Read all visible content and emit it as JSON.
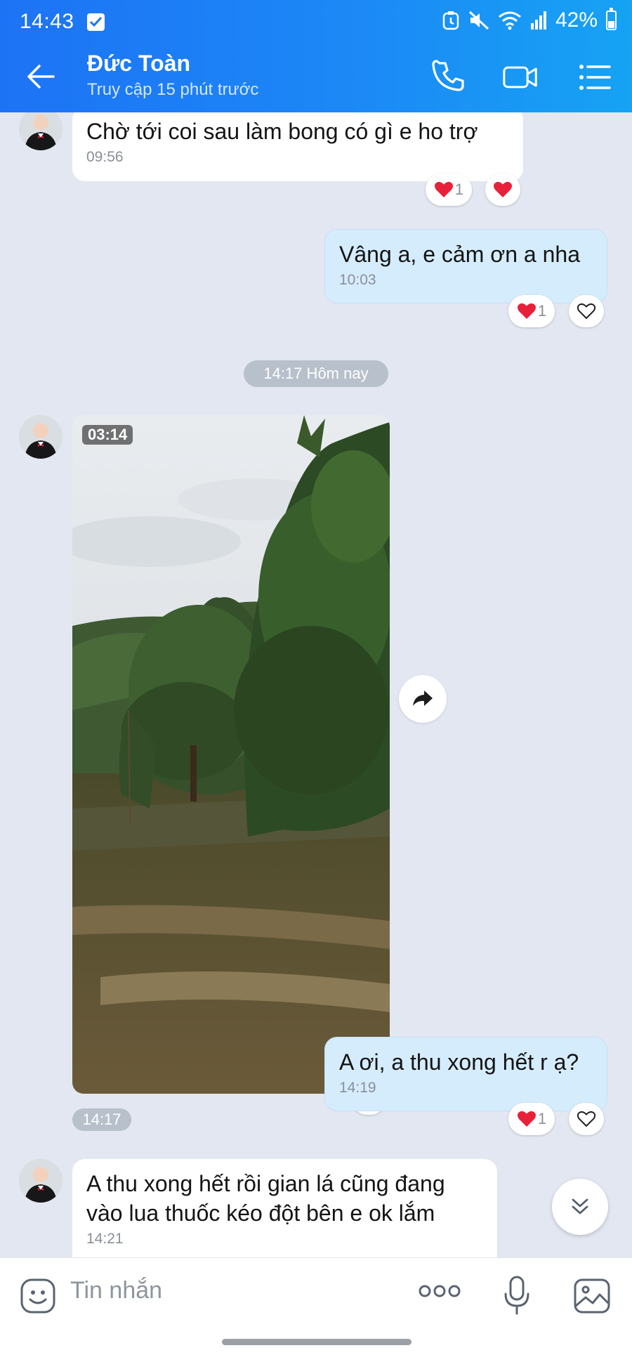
{
  "status_bar": {
    "time": "14:43",
    "battery": "42%",
    "battery_level": 0.42
  },
  "header": {
    "contact_name": "Đức Toàn",
    "presence": "Truy cập 15 phút trước"
  },
  "messages": [
    {
      "text": "Chờ tới coi sau làm bong có gì e ho trợ",
      "time": "09:56",
      "reaction_count": "1"
    },
    {
      "text": "Vâng a, e cảm ơn a nha",
      "time": "10:03",
      "reaction_count": "1"
    },
    {
      "date_separator": "14:17 Hôm nay"
    },
    {
      "video_duration": "03:14",
      "time": "14:17"
    },
    {
      "text": "A ơi, a thu xong hết r ạ?",
      "time": "14:19",
      "reaction_count": "1"
    },
    {
      "text_line1": "A thu xong hết rồi gian lá cũng đang",
      "text_line2": "vào lua thuốc kéo đột bên e ok lắm",
      "time": "14:21"
    }
  ],
  "input": {
    "placeholder": "Tin nhắn"
  },
  "colors": {
    "header_start": "#1d73f5",
    "header_end": "#16a3f4",
    "chat_bg": "#e2e7f1",
    "outgoing_bubble": "#d5ecfd",
    "incoming_bubble": "#ffffff",
    "heart": "#e8203a"
  },
  "icons": [
    "back-arrow-icon",
    "phone-icon",
    "video-call-icon",
    "menu-list-icon",
    "heart-icon",
    "forward-icon",
    "chevron-double-down-icon",
    "sticker-icon",
    "more-dots-icon",
    "microphone-icon",
    "image-icon"
  ]
}
